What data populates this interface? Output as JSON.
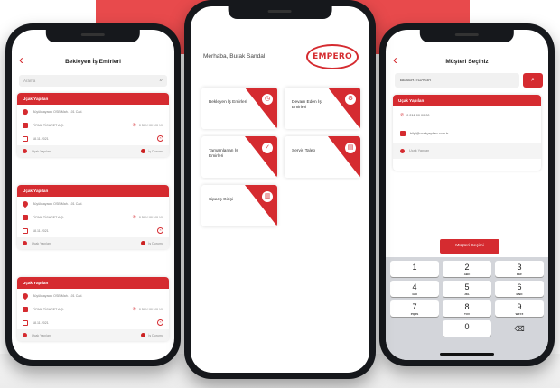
{
  "colors": {
    "accent": "#d52b30",
    "banner": "#e84a4c",
    "frame": "#16181c"
  },
  "left_screen": {
    "title": "Bekleyen İş Emirleri",
    "back_icon": "chevron-left-icon",
    "search_placeholder": "Arama",
    "cards": [
      {
        "header": "Uçak Yapılan",
        "address": "Büyükkayacık OSB Mah. 101 Cad.",
        "company": "FİRMA TİCARET A.Ş.",
        "phone": "0 5XX XX XX XX",
        "date": "18.11.2021",
        "assignee": "Uçak Yapılan",
        "status": "İş Durumu"
      },
      {
        "header": "Uçak Yapılan",
        "address": "Büyükkayacık OSB Mah. 101 Cad.",
        "company": "FİRMA TİCARET A.Ş.",
        "phone": "0 5XX XX XX XX",
        "date": "18.11.2021",
        "assignee": "Uçak Yapılan",
        "status": "İş Durumu"
      },
      {
        "header": "Uçak Yapılan",
        "address": "Büyükkayacık OSB Mah. 101 Cad.",
        "company": "FİRMA TİCARET A.Ş.",
        "phone": "0 5XX XX XX XX",
        "date": "18.11.2021",
        "assignee": "Uçak Yapılan",
        "status": "İş Durumu"
      }
    ]
  },
  "center_screen": {
    "greeting": "Merhaba, Burak Sandal",
    "logo": "EMPERO",
    "tiles": [
      {
        "label": "Bekleyen İş Emirleri",
        "icon": "clock-icon"
      },
      {
        "label": "Devam Eden İş Emirleri",
        "icon": "gear-icon"
      },
      {
        "label": "Tamamlanan İş Emirleri",
        "icon": "check-icon"
      },
      {
        "label": "Servis Talep",
        "icon": "form-icon"
      },
      {
        "label": "Sipariş Girişi",
        "icon": "cart-icon"
      }
    ]
  },
  "right_screen": {
    "title": "Müşteri Seçiniz",
    "search_value": "BESERTIGAGIA",
    "search_button_icon": "search-icon",
    "customer": {
      "header": "Uçak Yapılan",
      "phone": "0 212 00 00 00",
      "email": "bilgi@ucakyapilan.com.tr",
      "contact": "Uçak Yapılan"
    },
    "select_button": "Müşteri Seçimi",
    "keypad": [
      {
        "num": "1",
        "letters": ""
      },
      {
        "num": "2",
        "letters": "ABC"
      },
      {
        "num": "3",
        "letters": "DEF"
      },
      {
        "num": "4",
        "letters": "GHI"
      },
      {
        "num": "5",
        "letters": "JKL"
      },
      {
        "num": "6",
        "letters": "MNO"
      },
      {
        "num": "7",
        "letters": "PQRS"
      },
      {
        "num": "8",
        "letters": "TUV"
      },
      {
        "num": "9",
        "letters": "WXYZ"
      },
      {
        "num": "",
        "letters": ""
      },
      {
        "num": "0",
        "letters": ""
      },
      {
        "num": "⌫",
        "letters": ""
      }
    ]
  }
}
